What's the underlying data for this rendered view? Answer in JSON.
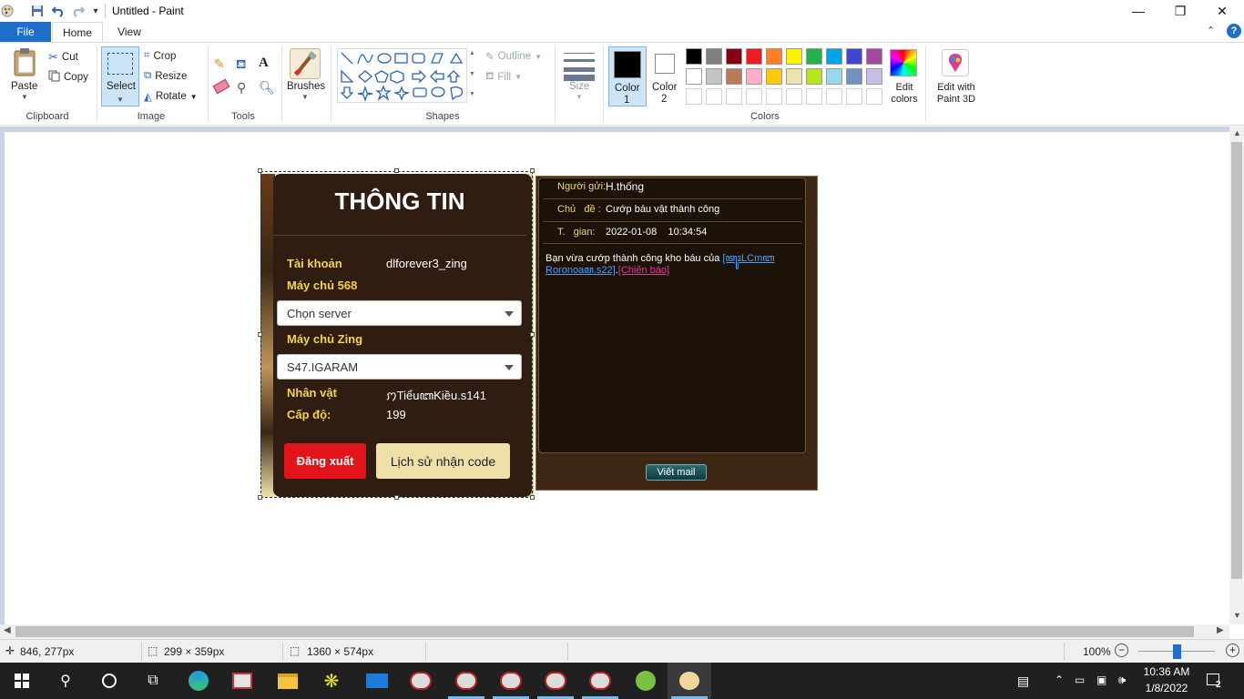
{
  "title_bar": {
    "title": "Untitled - Paint",
    "minimize": "—",
    "restore": "❐",
    "close": "✕"
  },
  "tabs": {
    "file": "File",
    "home": "Home",
    "view": "View"
  },
  "ribbon": {
    "clipboard": {
      "paste": "Paste",
      "cut": "Cut",
      "copy": "Copy",
      "label": "Clipboard"
    },
    "image": {
      "select": "Select",
      "crop": "Crop",
      "resize": "Resize",
      "rotate": "Rotate",
      "label": "Image"
    },
    "tools": {
      "label": "Tools"
    },
    "brushes": {
      "label": "Brushes"
    },
    "shapes": {
      "outline": "Outline",
      "fill": "Fill",
      "label": "Shapes"
    },
    "size": {
      "label": "Size"
    },
    "colors": {
      "color1": "Color",
      "color1_num": "1",
      "color2": "Color",
      "color2_num": "2",
      "edit_colors": "Edit colors",
      "edit_paint3d": "Edit with Paint 3D",
      "label": "Colors",
      "row1": [
        "#000000",
        "#7f7f7f",
        "#880015",
        "#ed1c24",
        "#ff7f27",
        "#fff200",
        "#22b14c",
        "#00a2e8",
        "#3f48cc",
        "#a349a4"
      ],
      "row2": [
        "#ffffff",
        "#c3c3c3",
        "#b97a57",
        "#ffaec9",
        "#ffc90e",
        "#efe4b0",
        "#b5e61d",
        "#99d9ea",
        "#7092be",
        "#c8bfe7"
      ]
    }
  },
  "game": {
    "title": "THÔNG TIN",
    "account_label": "Tài khoản",
    "account_value": "dlforever3_zing",
    "server568_label": "Máy chủ 568",
    "server568_select": "Chọn server",
    "serverzing_label": "Máy chủ Zing",
    "serverzing_select": "S47.IGARAM",
    "character_label": "Nhân vật",
    "character_value": "ꩀTiểuꦧKiều.s141",
    "level_label": "Cấp độ:",
    "level_value": "199",
    "logout_button": "Đăng xuất",
    "history_button": "Lịch sử nhận code"
  },
  "mail": {
    "sender_label": "Người gửi:",
    "sender_value": "H.thống",
    "subject_label": "Chủ   đề :",
    "subject_value": "Cướp báu vật thành công",
    "time_label": "T.   gian:",
    "time_value": "2022-01-08    10:34:54",
    "body_text": "Bạn vừa cướp thành công kho báu của ",
    "body_link1": "[ꦠꦸꦴLCmꦧ",
    "body_link1b": "Roronoaꦩ.s22]",
    "body_sep": ".",
    "body_link2": "[Chiến báo]",
    "write_button": "Viết mail"
  },
  "status": {
    "cursor_pos": "846, 277px",
    "selection_size": "299 × 359px",
    "image_size": "1360 × 574px",
    "zoom": "100%"
  },
  "taskbar": {
    "time": "10:36 AM",
    "date": "1/8/2022",
    "notifications": "2"
  }
}
